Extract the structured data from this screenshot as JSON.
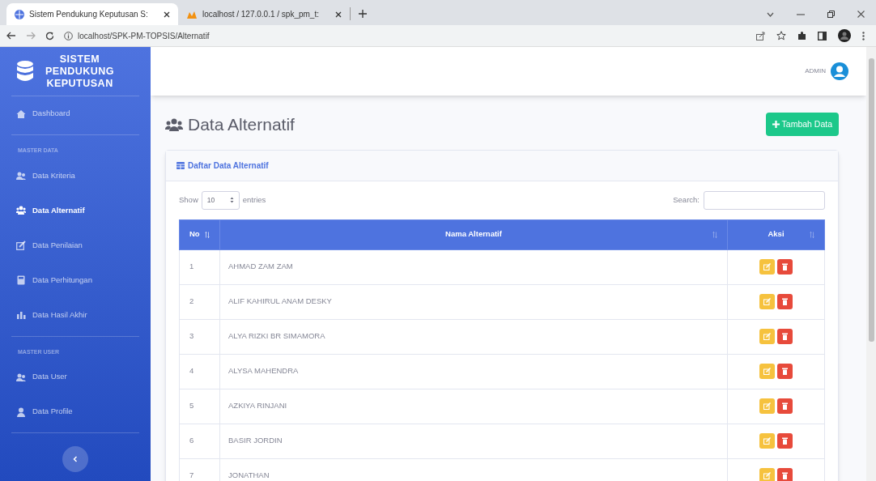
{
  "browser": {
    "tabs": [
      {
        "title": "Sistem Pendukung Keputusan S:",
        "selected": true
      },
      {
        "title": "localhost / 127.0.0.1 / spk_pm_t:",
        "selected": false
      }
    ],
    "url": "localhost/SPK-PM-TOPSIS/Alternatif"
  },
  "sidebar": {
    "brand": [
      "SISTEM",
      "PENDUKUNG",
      "KEPUTUSAN"
    ],
    "items": [
      {
        "kind": "link",
        "label": "Dashboard",
        "selected": false
      },
      {
        "kind": "divider"
      },
      {
        "kind": "heading",
        "label": "MASTER DATA"
      },
      {
        "kind": "link",
        "label": "Data Kriteria",
        "selected": false
      },
      {
        "kind": "link",
        "label": "Data Alternatif",
        "selected": true
      },
      {
        "kind": "link",
        "label": "Data Penilaian",
        "selected": false
      },
      {
        "kind": "link",
        "label": "Data Perhitungan",
        "selected": false
      },
      {
        "kind": "link",
        "label": "Data Hasil Akhir",
        "selected": false
      },
      {
        "kind": "divider"
      },
      {
        "kind": "heading",
        "label": "MASTER USER"
      },
      {
        "kind": "link",
        "label": "Data User",
        "selected": false
      },
      {
        "kind": "link",
        "label": "Data Profile",
        "selected": false
      },
      {
        "kind": "divider"
      }
    ]
  },
  "topbar": {
    "user": "ADMIN"
  },
  "page": {
    "title": "Data Alternatif",
    "add_button": "Tambah Data"
  },
  "card": {
    "title": "Daftar Data Alternatif",
    "show_label": "Show",
    "page_size": "10",
    "entries_label": "entries",
    "search_label": "Search:",
    "columns": [
      "No",
      "Nama Alternatif",
      "Aksi"
    ],
    "rows": [
      {
        "no": "1",
        "name": "AHMAD ZAM ZAM"
      },
      {
        "no": "2",
        "name": "ALIF KAHIRUL ANAM DESKY"
      },
      {
        "no": "3",
        "name": "ALYA RIZKI BR SIMAMORA"
      },
      {
        "no": "4",
        "name": "ALYSA MAHENDRA"
      },
      {
        "no": "5",
        "name": "AZKIYA RINJANI"
      },
      {
        "no": "6",
        "name": "BASIR JORDIN"
      },
      {
        "no": "7",
        "name": "JONATHAN"
      }
    ]
  }
}
